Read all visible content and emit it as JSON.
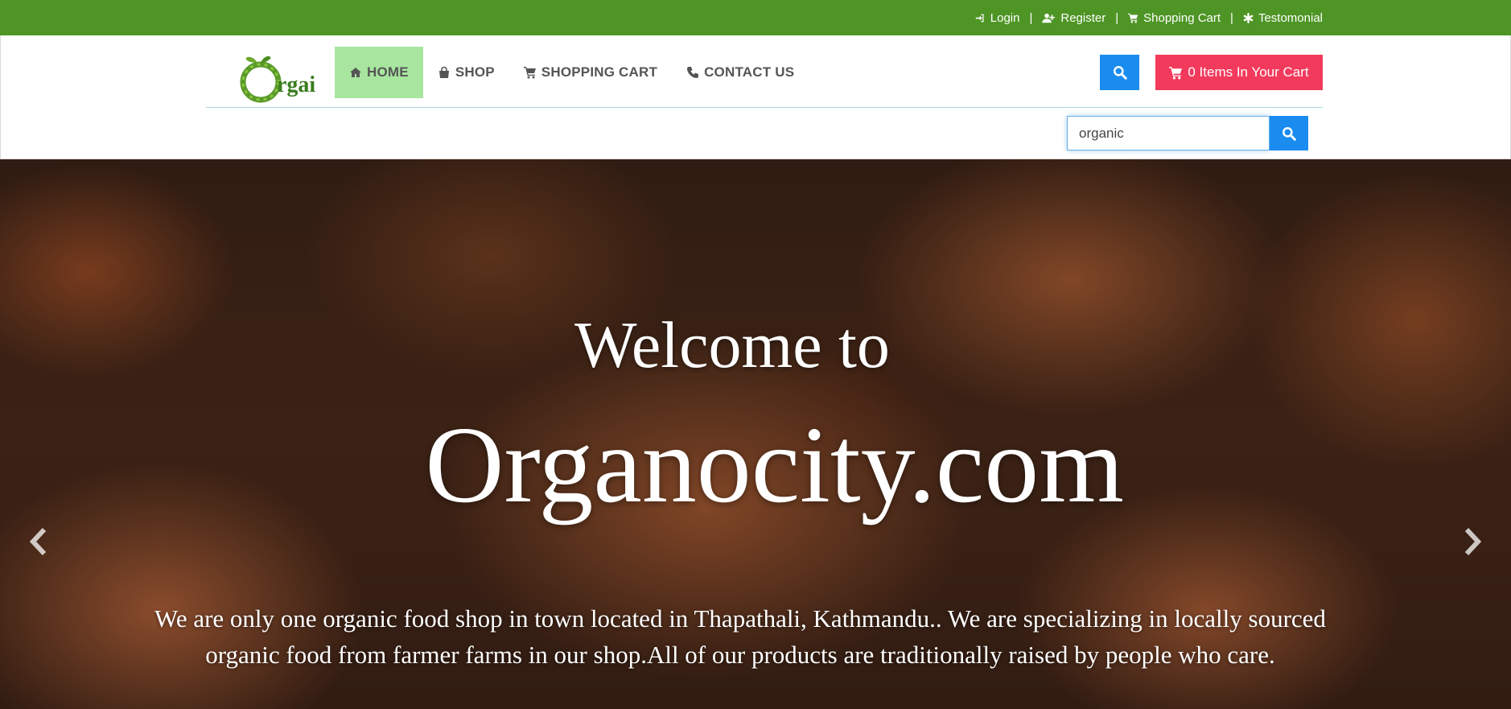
{
  "topbar": {
    "links": [
      {
        "label": "Login",
        "icon": "sign-in-icon"
      },
      {
        "label": "Register",
        "icon": "user-plus-icon"
      },
      {
        "label": "Shopping Cart",
        "icon": "cart-icon"
      },
      {
        "label": "Testomonial",
        "icon": "asterisk-icon"
      }
    ],
    "separator": "|"
  },
  "header": {
    "logo_text": "Orgai",
    "nav": [
      {
        "label": "HOME",
        "icon": "home-icon",
        "active": true
      },
      {
        "label": "SHOP",
        "icon": "shopping-bag-icon",
        "active": false
      },
      {
        "label": "SHOPPING CART",
        "icon": "cart-icon",
        "active": false
      },
      {
        "label": "CONTACT US",
        "icon": "phone-icon",
        "active": false
      }
    ],
    "cart_button_label": "0 Items In Your Cart",
    "search": {
      "value": "organic"
    }
  },
  "hero": {
    "welcome": "Welcome to",
    "site_name": "Organocity.com",
    "description": "We are  only one organic food shop in town located in Thapathali, Kathmandu.. We are specializing in locally sourced organic food from farmer farms in our shop.All of  our products are traditionally raised by people who care."
  },
  "colors": {
    "topbar": "#4e9525",
    "nav_active": "#a8e6a0",
    "search_button": "#1a8cf0",
    "cart_button": "#f23a5c"
  }
}
